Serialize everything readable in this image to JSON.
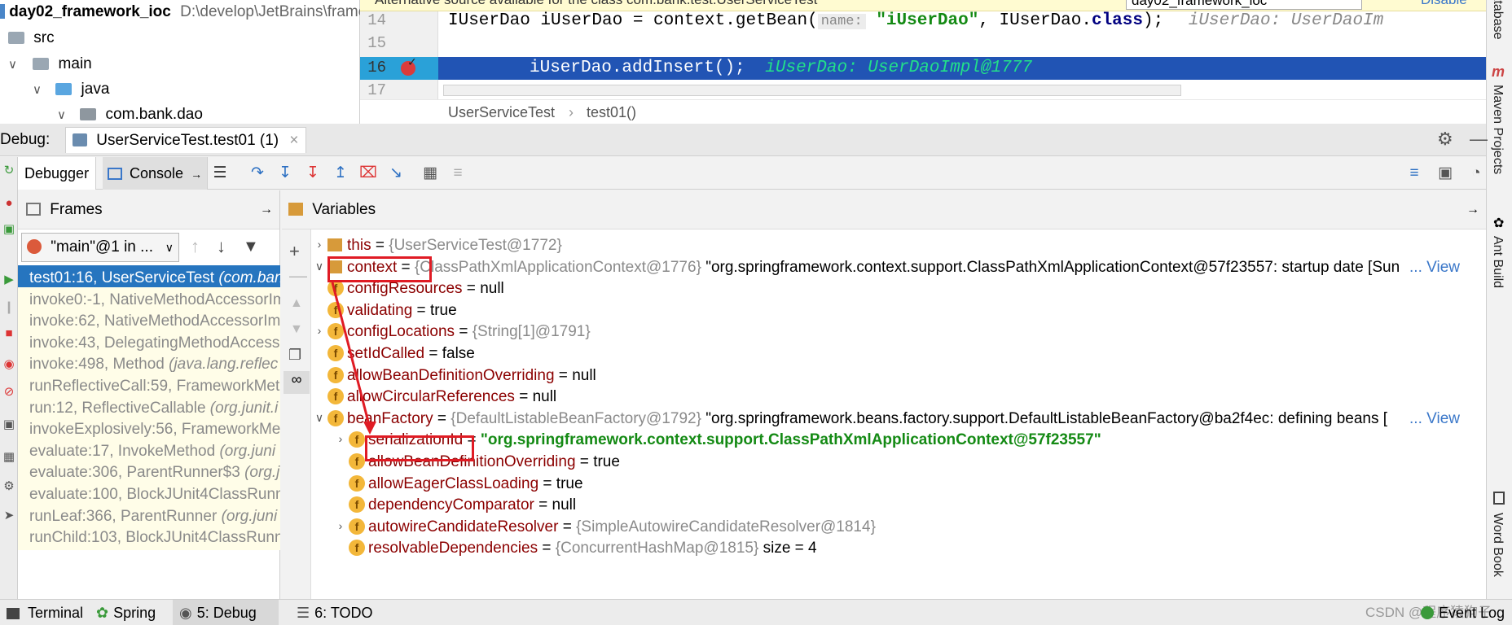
{
  "project": {
    "root_name": "day02_framework_ioc",
    "root_path": "D:\\develop\\JetBrains\\frame",
    "items": [
      {
        "label": "src"
      },
      {
        "label": "main"
      },
      {
        "label": "java"
      },
      {
        "label": "com.bank.dao"
      }
    ]
  },
  "editor": {
    "notification": "Alternative source available for the class com.bank.test.UserServiceTest",
    "notification_select": "day02_framework_ioc",
    "notification_action": "Disable",
    "lines": [
      {
        "num": "14",
        "code": "IUserDao iUserDao = context.getBean(",
        "hint": "name:",
        "code2": "\"iUserDao\"",
        "code3": ", IUserDao.",
        "kw": "class",
        "code4": ");",
        "inline": "iUserDao: UserDaoIm"
      },
      {
        "num": "15",
        "code": ""
      },
      {
        "num": "16",
        "code": "iUserDao.addInsert();",
        "inline": "iUserDao: UserDaoImpl@1777"
      },
      {
        "num": "17",
        "code": ""
      }
    ],
    "breadcrumb": [
      "UserServiceTest",
      "test01()"
    ]
  },
  "debug": {
    "title_label": "Debug:",
    "session_tab": "UserServiceTest.test01 (1)",
    "tab_debugger": "Debugger",
    "tab_console": "Console",
    "frames_title": "Frames",
    "thread": "\"main\"@1 in ...",
    "frames": [
      {
        "loc": "test01:16, UserServiceTest",
        "cls": "(com.ban"
      },
      {
        "loc": "invoke0:-1, NativeMethodAccessorIm",
        "cls": ""
      },
      {
        "loc": "invoke:62, NativeMethodAccessorIm",
        "cls": ""
      },
      {
        "loc": "invoke:43, DelegatingMethodAccess",
        "cls": ""
      },
      {
        "loc": "invoke:498, Method",
        "cls": "(java.lang.reflec"
      },
      {
        "loc": "runReflectiveCall:59, FrameworkMet",
        "cls": ""
      },
      {
        "loc": "run:12, ReflectiveCallable",
        "cls": "(org.junit.i"
      },
      {
        "loc": "invokeExplosively:56, FrameworkMe",
        "cls": ""
      },
      {
        "loc": "evaluate:17, InvokeMethod",
        "cls": "(org.juni"
      },
      {
        "loc": "evaluate:306, ParentRunner$3",
        "cls": "(org.j"
      },
      {
        "loc": "evaluate:100, BlockJUnit4ClassRunn",
        "cls": ""
      },
      {
        "loc": "runLeaf:366, ParentRunner",
        "cls": "(org.juni"
      },
      {
        "loc": "runChild:103, BlockJUnit4ClassRunn",
        "cls": ""
      }
    ],
    "variables_title": "Variables",
    "variables": [
      {
        "name": "this",
        "eq": " = ",
        "type": "{UserServiceTest@1772}",
        "value": "",
        "kind": "obj"
      },
      {
        "name": "context",
        "eq": " = ",
        "type": "{ClassPathXmlApplicationContext@1776}",
        "value": " \"org.springframework.context.support.ClassPathXmlApplicationContext@57f23557: startup date [Sun",
        "more": "... View",
        "kind": "obj"
      },
      {
        "name": "configResources",
        "eq": " = ",
        "type": "",
        "value": "null",
        "kind": "field"
      },
      {
        "name": "validating",
        "eq": " = ",
        "type": "",
        "value": "true",
        "kind": "field"
      },
      {
        "name": "configLocations",
        "eq": " = ",
        "type": "{String[1]@1791}",
        "value": "",
        "kind": "field"
      },
      {
        "name": "setIdCalled",
        "eq": " = ",
        "type": "",
        "value": "false",
        "kind": "field"
      },
      {
        "name": "allowBeanDefinitionOverriding",
        "eq": " = ",
        "type": "",
        "value": "null",
        "kind": "field"
      },
      {
        "name": "allowCircularReferences",
        "eq": " = ",
        "type": "",
        "value": "null",
        "kind": "field"
      },
      {
        "name": "beanFactory",
        "eq": " = ",
        "type": "{DefaultListableBeanFactory@1792}",
        "value": " \"org.springframework.beans.factory.support.DefaultListableBeanFactory@ba2f4ec: defining beans [",
        "more": "... View",
        "kind": "field"
      },
      {
        "name": "serializationId",
        "eq": " = ",
        "type": "",
        "value": "\"org.springframework.context.support.ClassPathXmlApplicationContext@57f23557\"",
        "kind": "field2"
      },
      {
        "name": "allowBeanDefinitionOverriding",
        "eq": " = ",
        "type": "",
        "value": "true",
        "kind": "field2"
      },
      {
        "name": "allowEagerClassLoading",
        "eq": " = ",
        "type": "",
        "value": "true",
        "kind": "field2"
      },
      {
        "name": "dependencyComparator",
        "eq": " = ",
        "type": "",
        "value": "null",
        "kind": "field2"
      },
      {
        "name": "autowireCandidateResolver",
        "eq": " = ",
        "type": "{SimpleAutowireCandidateResolver@1814}",
        "value": "",
        "kind": "field2"
      },
      {
        "name": "resolvableDependencies",
        "eq": " = ",
        "type": "{ConcurrentHashMap@1815}",
        "value": " size = 4",
        "kind": "field2"
      }
    ]
  },
  "right_sidebar": [
    "Database",
    "Maven Projects",
    "Ant Build",
    "Word Book"
  ],
  "bottom": {
    "tabs": [
      {
        "label": "Terminal"
      },
      {
        "label": "Spring"
      },
      {
        "label": "5: Debug"
      },
      {
        "label": "6: TODO"
      }
    ],
    "event_log": "Event Log",
    "watermark": "CSDN @程序猿狗子"
  },
  "colors": {
    "highlight": "#2675bf",
    "annotation_red": "#e01b24",
    "field_badge": "#f3b73a",
    "string_green": "#148a14"
  }
}
